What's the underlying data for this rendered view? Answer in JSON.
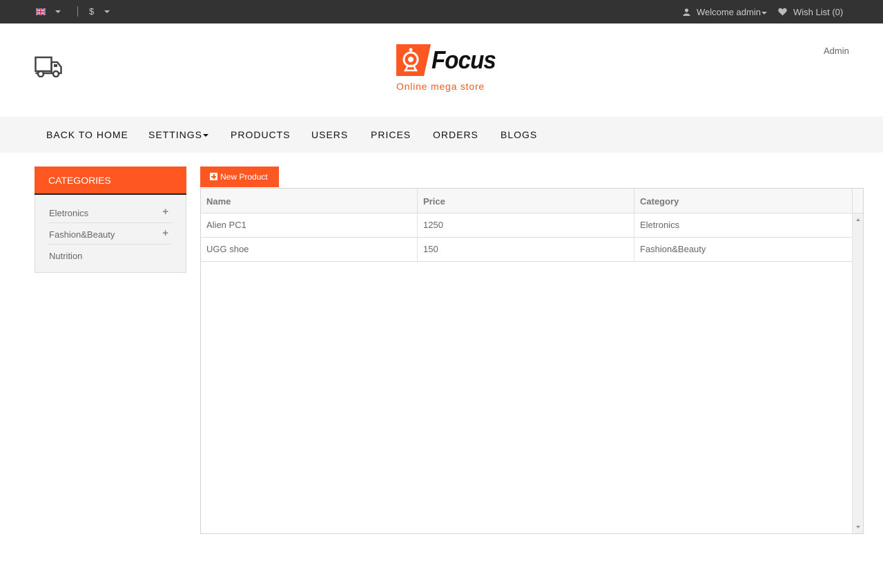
{
  "topbar": {
    "language_icon": "uk-flag-icon",
    "currency": "$",
    "welcome": "Welcome admin",
    "wishlist": "Wish List (0)"
  },
  "header": {
    "logo_text": "Focus",
    "tagline": "Online mega store",
    "admin_link": "Admin"
  },
  "nav": {
    "items": [
      "BACK TO HOME",
      "SETTINGS",
      "PRODUCTS",
      "USERS",
      "PRICES",
      "ORDERS",
      "BLOGS"
    ]
  },
  "sidebar": {
    "title": "CATEGORIES",
    "items": [
      {
        "label": "Eletronics",
        "expandable": true
      },
      {
        "label": "Fashion&Beauty",
        "expandable": true
      },
      {
        "label": "Nutrition",
        "expandable": false
      }
    ],
    "expand_symbol": "+"
  },
  "content": {
    "new_button": "New Product",
    "table": {
      "columns": [
        "Name",
        "Price",
        "Category"
      ],
      "rows": [
        [
          "Alien PC1",
          "1250",
          "Eletronics"
        ],
        [
          "UGG shoe",
          "150",
          "Fashion&Beauty"
        ]
      ]
    }
  },
  "colors": {
    "accent": "#fe5722",
    "topbar": "#333333",
    "nav_bg": "#f5f5f5"
  }
}
